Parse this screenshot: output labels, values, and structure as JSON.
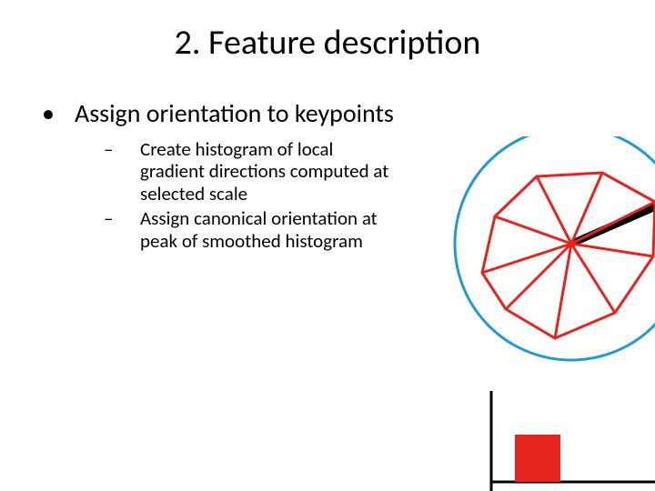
{
  "title": "2. Feature description",
  "level1": {
    "bullet": "•",
    "text": "Assign orientation to keypoints"
  },
  "level2": [
    {
      "dash": "–",
      "text": "Create histogram of local gradient directions computed at selected scale"
    },
    {
      "dash": "–",
      "text": "Assign canonical orientation at peak of smoothed histogram"
    }
  ],
  "colors": {
    "circle": "#1f9bd1",
    "rose": "#e52420",
    "axis": "#000000",
    "bar": "#e52420"
  }
}
